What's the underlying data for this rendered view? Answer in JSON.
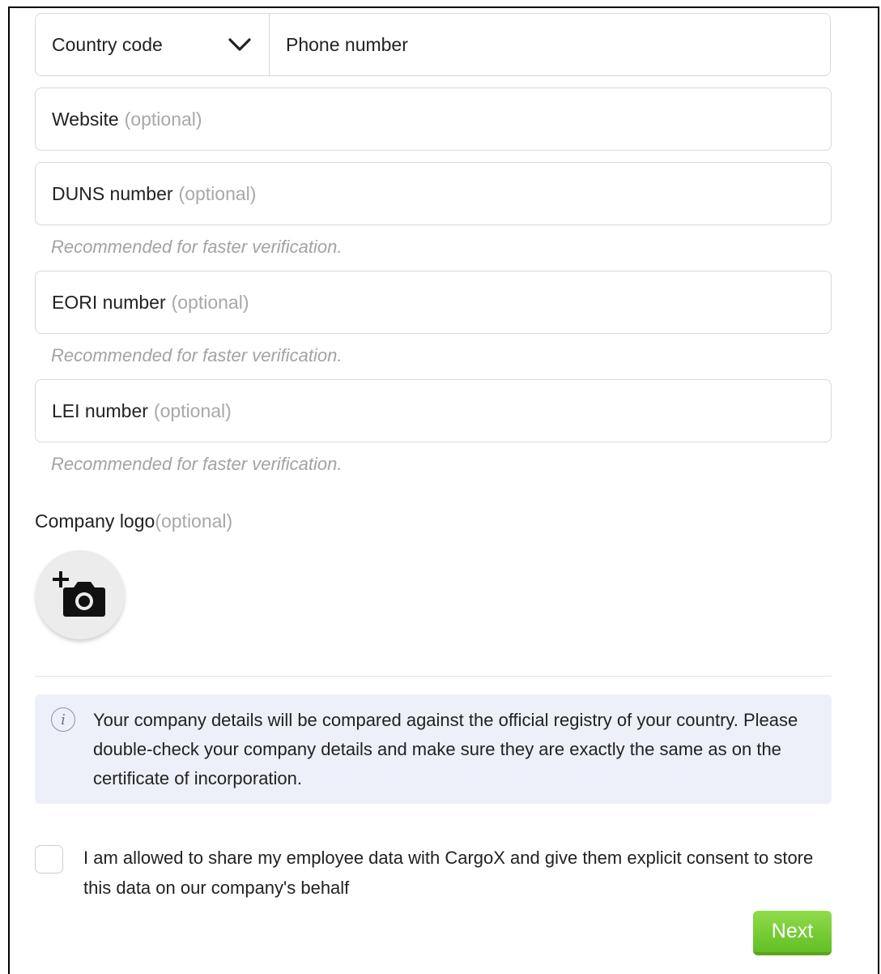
{
  "phone": {
    "country_code_placeholder": "Country code",
    "country_code_icon": "chevron-down-icon",
    "phone_placeholder": "Phone number"
  },
  "fields": {
    "website": {
      "label": "Website",
      "optional": "(optional)"
    },
    "duns": {
      "label": "DUNS number",
      "optional": "(optional)",
      "hint": "Recommended for faster verification."
    },
    "eori": {
      "label": "EORI number",
      "optional": "(optional)",
      "hint": "Recommended for faster verification."
    },
    "lei": {
      "label": "LEI number",
      "optional": "(optional)",
      "hint": "Recommended for faster verification."
    }
  },
  "company_logo": {
    "label": "Company logo",
    "optional": "(optional)",
    "icon": "add-photo-camera-icon"
  },
  "info": {
    "icon": "info-icon",
    "text": "Your company details will be compared against the official registry of your country. Please double-check your company details and make sure they are exactly the same as on the certificate of incorporation."
  },
  "consent": {
    "checked": false,
    "text": "I am allowed to share my employee data with CargoX and give them explicit consent to store this data on our company's behalf"
  },
  "next_button": {
    "label": "Next",
    "color": "#6cc72e"
  }
}
